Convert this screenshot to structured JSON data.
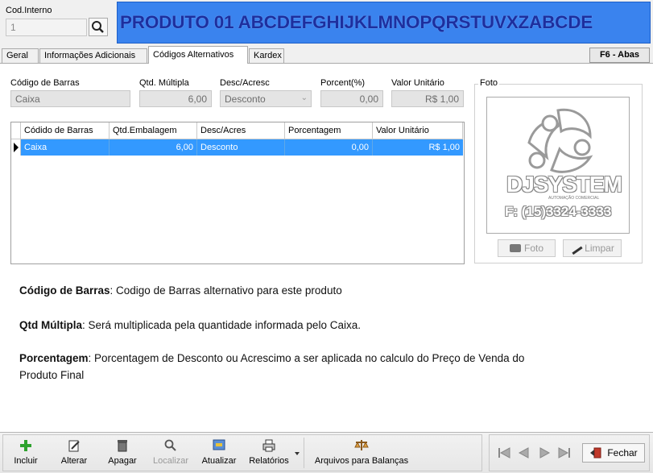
{
  "header": {
    "cod_label": "Cod.Interno",
    "cod_value": "1",
    "product_title": "PRODUTO 01 ABCDEFGHIJKLMNOPQRSTUVXZABCDE"
  },
  "tabs": [
    {
      "label": "Geral"
    },
    {
      "label": "Informações Adicionais"
    },
    {
      "label": "Códigos Alternativos"
    },
    {
      "label": "Kardex"
    }
  ],
  "shortcut": "F6 - Abas",
  "form": {
    "barcode_label": "Código de Barras",
    "barcode_value": "Caixa",
    "qty_label": "Qtd. Múltipla",
    "qty_value": "6,00",
    "desc_label": "Desc/Acresc",
    "desc_value": "Desconto",
    "pct_label": "Porcent(%)",
    "pct_value": "0,00",
    "unit_label": "Valor Unitário",
    "unit_value": "R$ 1,00"
  },
  "grid": {
    "columns": [
      "Códido de  Barras",
      "Qtd.Embalagem",
      "Desc/Acres",
      "Porcentagem",
      "Valor Unitário"
    ],
    "rows": [
      {
        "barcode": "Caixa",
        "qty": "6,00",
        "desc": "Desconto",
        "pct": "0,00",
        "unit": "R$ 1,00"
      }
    ]
  },
  "photo": {
    "label": "Foto",
    "logo_name": "DJSYSTEM",
    "logo_sub": "AUTOMAÇÃO COMERCIAL",
    "logo_phone": "F: (15)3324-3333",
    "btn_photo": "Foto",
    "btn_clear": "Limpar"
  },
  "help": {
    "line1_bold": "Código de Barras",
    "line1_text": ": Codigo de Barras alternativo para este produto",
    "line2_bold": "Qtd Múltipla",
    "line2_text": ": Será multiplicada pela quantidade informada pelo Caixa.",
    "line3_bold": "Porcentagem",
    "line3_text": ": Porcentagem de Desconto ou Acrescimo a ser aplicada no calculo do Preço de Venda do",
    "line3_cont": "Produto Final"
  },
  "toolbar": {
    "incluir": "Incluir",
    "alterar": "Alterar",
    "apagar": "Apagar",
    "localizar": "Localizar",
    "atualizar": "Atualizar",
    "relatorios": "Relatórios",
    "balancas": "Arquivos para Balanças",
    "fechar": "Fechar"
  },
  "colors": {
    "title_bg": "#2f79e8",
    "title_text": "#1b2fa8",
    "selection": "#3399ff"
  }
}
